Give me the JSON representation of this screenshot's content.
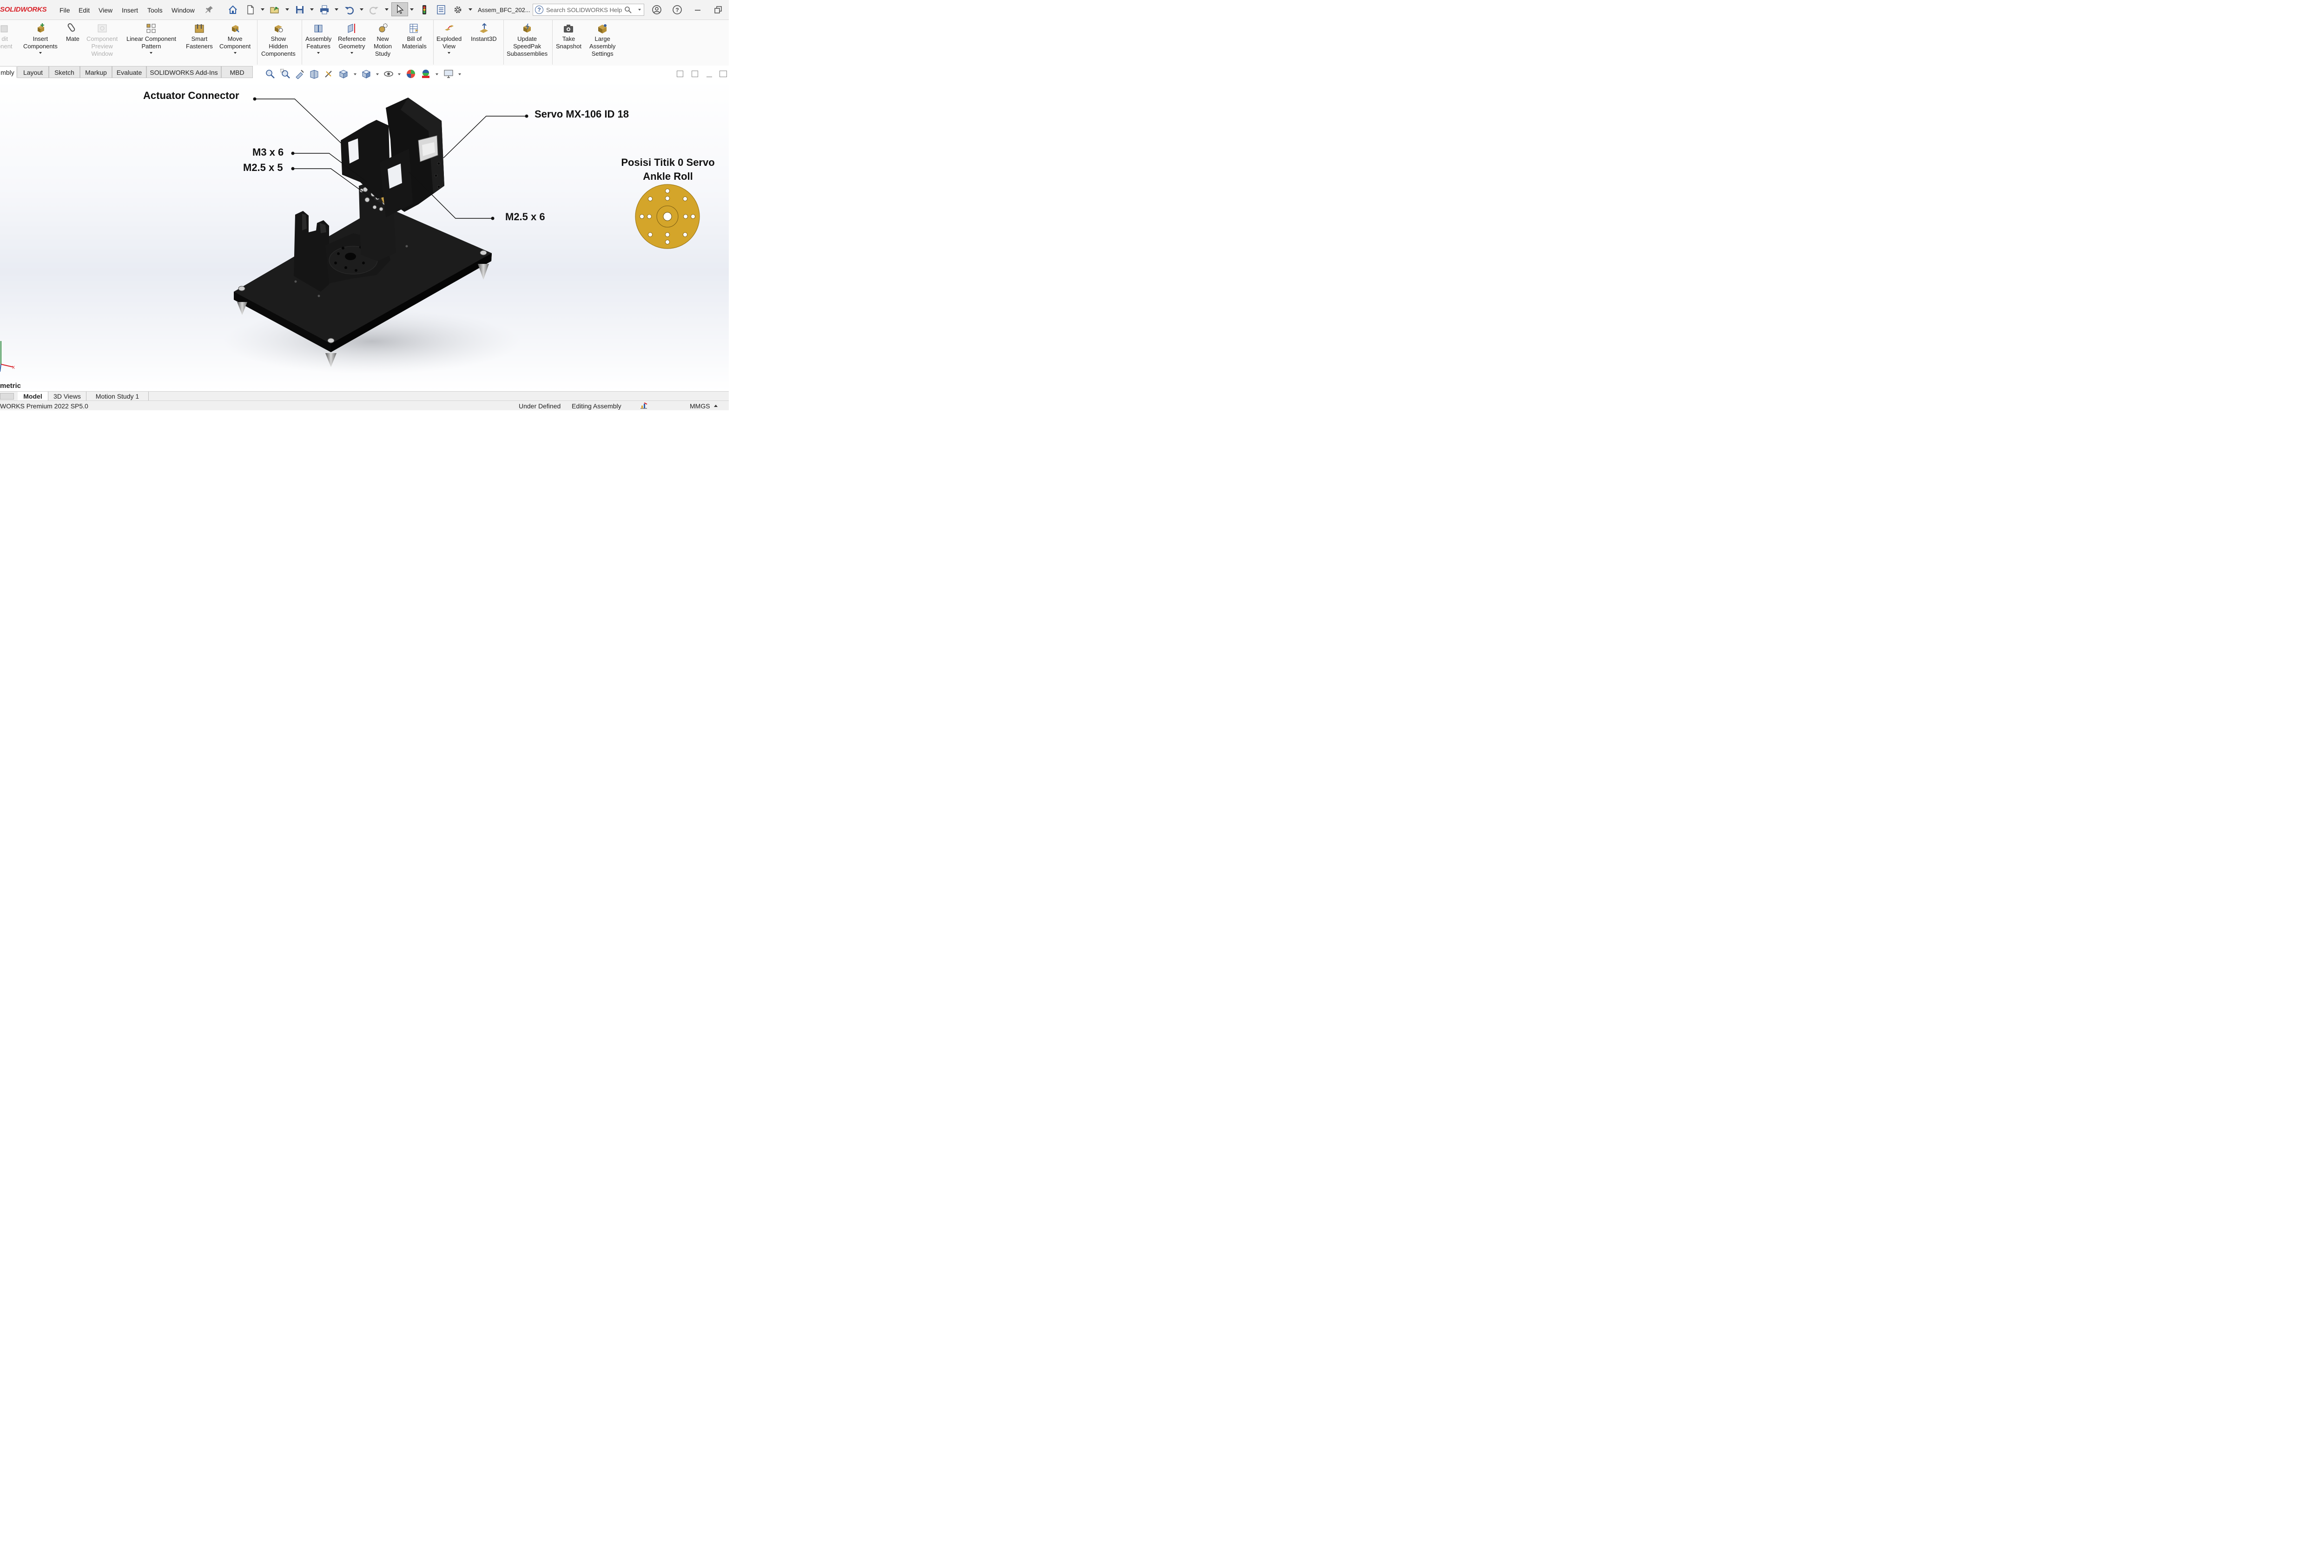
{
  "app": {
    "logo": "SOLIDWORKS"
  },
  "menu": {
    "items": [
      "File",
      "Edit",
      "View",
      "Insert",
      "Tools",
      "Window"
    ]
  },
  "document": {
    "title": "Assem_BFC_202..."
  },
  "search": {
    "placeholder": "Search SOLIDWORKS Help"
  },
  "commands": [
    {
      "label": "dit\nonent",
      "icon": "edit-component-icon"
    },
    {
      "label": "Insert\nComponents",
      "icon": "insert-components-icon"
    },
    {
      "label": "Mate",
      "icon": "mate-icon"
    },
    {
      "label": "Component\nPreview\nWindow",
      "icon": "component-preview-icon"
    },
    {
      "label": "Linear Component\nPattern",
      "icon": "linear-pattern-icon"
    },
    {
      "label": "Smart\nFasteners",
      "icon": "smart-fasteners-icon"
    },
    {
      "label": "Move\nComponent",
      "icon": "move-component-icon"
    },
    {
      "label": "Show\nHidden\nComponents",
      "icon": "show-hidden-icon"
    },
    {
      "label": "Assembly\nFeatures",
      "icon": "assembly-features-icon"
    },
    {
      "label": "Reference\nGeometry",
      "icon": "reference-geometry-icon"
    },
    {
      "label": "New\nMotion\nStudy",
      "icon": "motion-study-icon"
    },
    {
      "label": "Bill of\nMaterials",
      "icon": "bom-icon"
    },
    {
      "label": "Exploded\nView",
      "icon": "exploded-view-icon"
    },
    {
      "label": "Instant3D",
      "icon": "instant3d-icon"
    },
    {
      "label": "Update\nSpeedPak\nSubassemblies",
      "icon": "speedpak-icon"
    },
    {
      "label": "Take\nSnapshot",
      "icon": "snapshot-icon"
    },
    {
      "label": "Large\nAssembly\nSettings",
      "icon": "large-assembly-icon"
    }
  ],
  "tabs": [
    "mbly",
    "Layout",
    "Sketch",
    "Markup",
    "Evaluate",
    "SOLIDWORKS Add-Ins",
    "MBD"
  ],
  "callouts": {
    "actuator": "Actuator Connector",
    "servo": "Servo MX-106 ID 18",
    "m3x6": "M3 x 6",
    "m25x5": "M2.5 x 5",
    "m25x6": "M2.5 x 6"
  },
  "zero_position": {
    "line1": "Posisi Titik 0 Servo",
    "line2": "Ankle Roll",
    "horn_color": "#d4a52a"
  },
  "view_name": "metric",
  "bottom_tabs": [
    "Model",
    "3D Views",
    "Motion Study 1"
  ],
  "status": {
    "version": "WORKS Premium 2022 SP5.0",
    "under_defined": "Under Defined",
    "editing": "Editing Assembly",
    "units": "MMGS"
  },
  "colors": {
    "logo_red": "#d9242b",
    "part_black": "#161616",
    "brass": "#c9a24a"
  }
}
